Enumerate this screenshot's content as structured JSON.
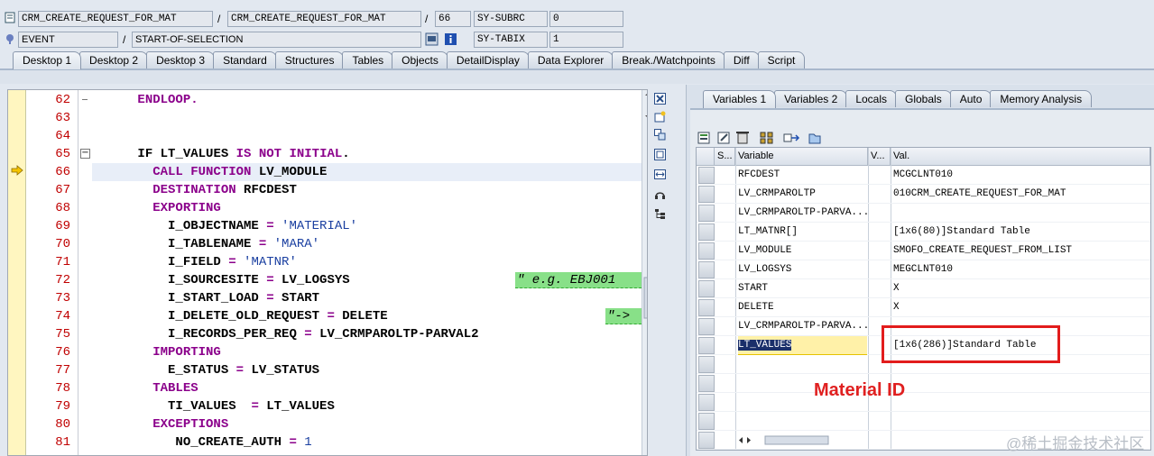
{
  "header": {
    "program": "CRM_CREATE_REQUEST_FOR_MAT",
    "include": "CRM_CREATE_REQUEST_FOR_MAT",
    "line": "66",
    "sysvar1_name": "SY-SUBRC",
    "sysvar1_value": "0",
    "event_type": "EVENT",
    "event_name": "START-OF-SELECTION",
    "sysvar2_name": "SY-TABIX",
    "sysvar2_value": "1",
    "slash": "/"
  },
  "tabs": [
    "Desktop 1",
    "Desktop 2",
    "Desktop 3",
    "Standard",
    "Structures",
    "Tables",
    "Objects",
    "DetailDisplay",
    "Data Explorer",
    "Break./Watchpoints",
    "Diff",
    "Script"
  ],
  "code": {
    "lines": [
      {
        "no": "62",
        "indent": "      ",
        "parts": [
          {
            "t": "ENDLOOP",
            "c": "kw"
          },
          {
            "t": ".",
            "c": "kw"
          }
        ]
      },
      {
        "no": "63",
        "indent": "",
        "parts": []
      },
      {
        "no": "64",
        "indent": "",
        "parts": []
      },
      {
        "no": "65",
        "indent": "      ",
        "parts": [
          {
            "t": "IF ",
            "c": "id"
          },
          {
            "t": "LT_VALUES ",
            "c": "id"
          },
          {
            "t": "IS NOT INITIAL",
            "c": "kw"
          },
          {
            "t": ".",
            "c": "id"
          }
        ]
      },
      {
        "no": "66",
        "indent": "        ",
        "parts": [
          {
            "t": "CALL FUNCTION ",
            "c": "kw"
          },
          {
            "t": "LV_MODULE",
            "c": "id"
          }
        ]
      },
      {
        "no": "67",
        "indent": "        ",
        "parts": [
          {
            "t": "DESTINATION ",
            "c": "kw"
          },
          {
            "t": "RFCDEST",
            "c": "id"
          }
        ]
      },
      {
        "no": "68",
        "indent": "        ",
        "parts": [
          {
            "t": "EXPORTING",
            "c": "kw"
          }
        ]
      },
      {
        "no": "69",
        "indent": "          ",
        "parts": [
          {
            "t": "I_OBJECTNAME ",
            "c": "id"
          },
          {
            "t": "= ",
            "c": "kw"
          },
          {
            "t": "'MATERIAL'",
            "c": "str"
          }
        ]
      },
      {
        "no": "70",
        "indent": "          ",
        "parts": [
          {
            "t": "I_TABLENAME ",
            "c": "id"
          },
          {
            "t": "= ",
            "c": "kw"
          },
          {
            "t": "'MARA'",
            "c": "str"
          }
        ]
      },
      {
        "no": "71",
        "indent": "          ",
        "parts": [
          {
            "t": "I_FIELD ",
            "c": "id"
          },
          {
            "t": "= ",
            "c": "kw"
          },
          {
            "t": "'MATNR'",
            "c": "str"
          }
        ]
      },
      {
        "no": "72",
        "indent": "          ",
        "parts": [
          {
            "t": "I_SOURCESITE ",
            "c": "id"
          },
          {
            "t": "= ",
            "c": "kw"
          },
          {
            "t": "LV_LOGSYS",
            "c": "id"
          }
        ]
      },
      {
        "no": "73",
        "indent": "          ",
        "parts": [
          {
            "t": "I_START_LOAD ",
            "c": "id"
          },
          {
            "t": "= ",
            "c": "kw"
          },
          {
            "t": "START",
            "c": "id"
          }
        ]
      },
      {
        "no": "74",
        "indent": "          ",
        "parts": [
          {
            "t": "I_DELETE_OLD_REQUEST ",
            "c": "id"
          },
          {
            "t": "= ",
            "c": "kw"
          },
          {
            "t": "DELETE",
            "c": "id"
          }
        ]
      },
      {
        "no": "75",
        "indent": "          ",
        "parts": [
          {
            "t": "I_RECORDS_PER_REQ ",
            "c": "id"
          },
          {
            "t": "= ",
            "c": "kw"
          },
          {
            "t": "LV_CRMPAROLTP-PARVAL2",
            "c": "id"
          }
        ]
      },
      {
        "no": "76",
        "indent": "        ",
        "parts": [
          {
            "t": "IMPORTING",
            "c": "kw"
          }
        ]
      },
      {
        "no": "77",
        "indent": "          ",
        "parts": [
          {
            "t": "E_STATUS ",
            "c": "id"
          },
          {
            "t": "= ",
            "c": "kw"
          },
          {
            "t": "LV_STATUS",
            "c": "id"
          }
        ]
      },
      {
        "no": "78",
        "indent": "        ",
        "parts": [
          {
            "t": "TABLES",
            "c": "kw"
          }
        ]
      },
      {
        "no": "79",
        "indent": "          ",
        "parts": [
          {
            "t": "TI_VALUES  ",
            "c": "id"
          },
          {
            "t": "= ",
            "c": "kw"
          },
          {
            "t": "LT_VALUES",
            "c": "id"
          }
        ]
      },
      {
        "no": "80",
        "indent": "        ",
        "parts": [
          {
            "t": "EXCEPTIONS",
            "c": "kw"
          }
        ]
      },
      {
        "no": "81",
        "indent": "           ",
        "parts": [
          {
            "t": "NO_CREATE_AUTH ",
            "c": "id"
          },
          {
            "t": "= ",
            "c": "kw"
          },
          {
            "t": "1",
            "c": "num"
          }
        ]
      }
    ],
    "comment_72": "\" e.g. EBJ001",
    "comment_74": "\"->"
  },
  "right": {
    "tabs": [
      "Variables 1",
      "Variables 2",
      "Locals",
      "Globals",
      "Auto",
      "Memory Analysis"
    ],
    "col_s": "S...",
    "col_variable": "Variable",
    "col_v": "V...",
    "col_val": "Val.",
    "rows": [
      {
        "var": "RFCDEST",
        "val": "MCGCLNT010"
      },
      {
        "var": "LV_CRMPAROLTP",
        "val": "010CRM_CREATE_REQUEST_FOR_MAT"
      },
      {
        "var": "LV_CRMPAROLTP-PARVA...",
        "val": ""
      },
      {
        "var": "LT_MATNR[]",
        "val": "[1x6(80)]Standard Table"
      },
      {
        "var": "LV_MODULE",
        "val": "SMOFO_CREATE_REQUEST_FROM_LIST"
      },
      {
        "var": "LV_LOGSYS",
        "val": "MEGCLNT010"
      },
      {
        "var": "START",
        "val": "X"
      },
      {
        "var": "DELETE",
        "val": "X"
      },
      {
        "var": "LV_CRMPAROLTP-PARVA...",
        "val": ""
      },
      {
        "var": "LT_VALUES",
        "val": "[1x6(286)]Standard Table"
      }
    ]
  },
  "annotation": {
    "label": "Material ID",
    "color": "#e21c1c"
  },
  "watermark": "@稀土掘金技术社区"
}
